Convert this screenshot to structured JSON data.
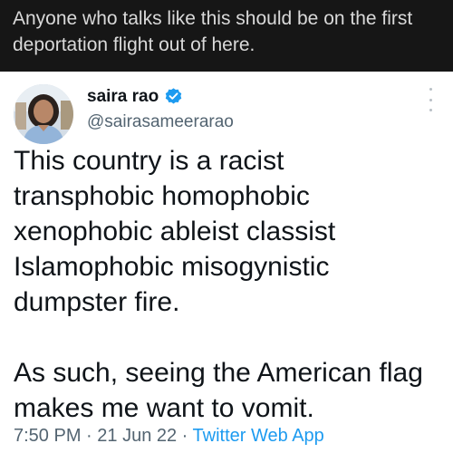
{
  "banner": {
    "line1": "Anyone who talks like this should be on the first",
    "line2": "deportation flight out of here."
  },
  "tweet": {
    "display_name": "saira rao",
    "handle": "@sairasameerarao",
    "verified": true,
    "verified_icon": "verified-badge-icon",
    "more_icon": "more-vertical-icon",
    "body_lines_p1": [
      "This country is a racist",
      "transphobic homophobic",
      "xenophobic ableist classist",
      "Islamophobic misogynistic",
      "dumpster fire."
    ],
    "body_lines_p2": [
      "As such, seeing the American flag",
      "makes me want to vomit."
    ],
    "time": "7:50 PM",
    "sep": " · ",
    "date": "21 Jun 22",
    "source": "Twitter Web App",
    "accent_color": "#1d9bf0"
  }
}
